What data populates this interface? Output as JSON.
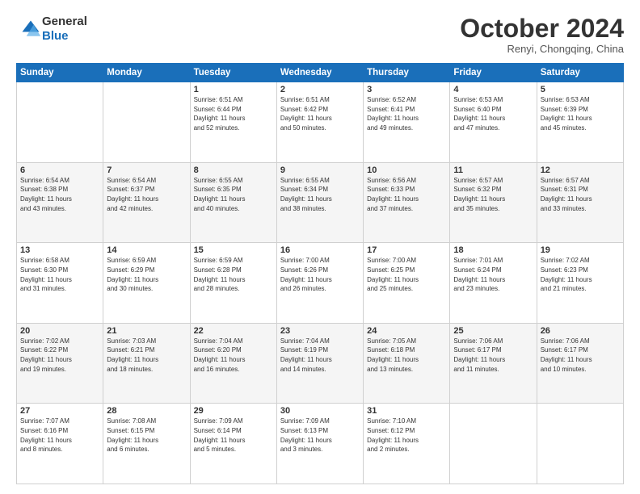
{
  "header": {
    "logo_line1": "General",
    "logo_line2": "Blue",
    "month": "October 2024",
    "location": "Renyi, Chongqing, China"
  },
  "weekdays": [
    "Sunday",
    "Monday",
    "Tuesday",
    "Wednesday",
    "Thursday",
    "Friday",
    "Saturday"
  ],
  "weeks": [
    [
      {
        "day": "",
        "info": ""
      },
      {
        "day": "",
        "info": ""
      },
      {
        "day": "1",
        "info": "Sunrise: 6:51 AM\nSunset: 6:44 PM\nDaylight: 11 hours\nand 52 minutes."
      },
      {
        "day": "2",
        "info": "Sunrise: 6:51 AM\nSunset: 6:42 PM\nDaylight: 11 hours\nand 50 minutes."
      },
      {
        "day": "3",
        "info": "Sunrise: 6:52 AM\nSunset: 6:41 PM\nDaylight: 11 hours\nand 49 minutes."
      },
      {
        "day": "4",
        "info": "Sunrise: 6:53 AM\nSunset: 6:40 PM\nDaylight: 11 hours\nand 47 minutes."
      },
      {
        "day": "5",
        "info": "Sunrise: 6:53 AM\nSunset: 6:39 PM\nDaylight: 11 hours\nand 45 minutes."
      }
    ],
    [
      {
        "day": "6",
        "info": "Sunrise: 6:54 AM\nSunset: 6:38 PM\nDaylight: 11 hours\nand 43 minutes."
      },
      {
        "day": "7",
        "info": "Sunrise: 6:54 AM\nSunset: 6:37 PM\nDaylight: 11 hours\nand 42 minutes."
      },
      {
        "day": "8",
        "info": "Sunrise: 6:55 AM\nSunset: 6:35 PM\nDaylight: 11 hours\nand 40 minutes."
      },
      {
        "day": "9",
        "info": "Sunrise: 6:55 AM\nSunset: 6:34 PM\nDaylight: 11 hours\nand 38 minutes."
      },
      {
        "day": "10",
        "info": "Sunrise: 6:56 AM\nSunset: 6:33 PM\nDaylight: 11 hours\nand 37 minutes."
      },
      {
        "day": "11",
        "info": "Sunrise: 6:57 AM\nSunset: 6:32 PM\nDaylight: 11 hours\nand 35 minutes."
      },
      {
        "day": "12",
        "info": "Sunrise: 6:57 AM\nSunset: 6:31 PM\nDaylight: 11 hours\nand 33 minutes."
      }
    ],
    [
      {
        "day": "13",
        "info": "Sunrise: 6:58 AM\nSunset: 6:30 PM\nDaylight: 11 hours\nand 31 minutes."
      },
      {
        "day": "14",
        "info": "Sunrise: 6:59 AM\nSunset: 6:29 PM\nDaylight: 11 hours\nand 30 minutes."
      },
      {
        "day": "15",
        "info": "Sunrise: 6:59 AM\nSunset: 6:28 PM\nDaylight: 11 hours\nand 28 minutes."
      },
      {
        "day": "16",
        "info": "Sunrise: 7:00 AM\nSunset: 6:26 PM\nDaylight: 11 hours\nand 26 minutes."
      },
      {
        "day": "17",
        "info": "Sunrise: 7:00 AM\nSunset: 6:25 PM\nDaylight: 11 hours\nand 25 minutes."
      },
      {
        "day": "18",
        "info": "Sunrise: 7:01 AM\nSunset: 6:24 PM\nDaylight: 11 hours\nand 23 minutes."
      },
      {
        "day": "19",
        "info": "Sunrise: 7:02 AM\nSunset: 6:23 PM\nDaylight: 11 hours\nand 21 minutes."
      }
    ],
    [
      {
        "day": "20",
        "info": "Sunrise: 7:02 AM\nSunset: 6:22 PM\nDaylight: 11 hours\nand 19 minutes."
      },
      {
        "day": "21",
        "info": "Sunrise: 7:03 AM\nSunset: 6:21 PM\nDaylight: 11 hours\nand 18 minutes."
      },
      {
        "day": "22",
        "info": "Sunrise: 7:04 AM\nSunset: 6:20 PM\nDaylight: 11 hours\nand 16 minutes."
      },
      {
        "day": "23",
        "info": "Sunrise: 7:04 AM\nSunset: 6:19 PM\nDaylight: 11 hours\nand 14 minutes."
      },
      {
        "day": "24",
        "info": "Sunrise: 7:05 AM\nSunset: 6:18 PM\nDaylight: 11 hours\nand 13 minutes."
      },
      {
        "day": "25",
        "info": "Sunrise: 7:06 AM\nSunset: 6:17 PM\nDaylight: 11 hours\nand 11 minutes."
      },
      {
        "day": "26",
        "info": "Sunrise: 7:06 AM\nSunset: 6:17 PM\nDaylight: 11 hours\nand 10 minutes."
      }
    ],
    [
      {
        "day": "27",
        "info": "Sunrise: 7:07 AM\nSunset: 6:16 PM\nDaylight: 11 hours\nand 8 minutes."
      },
      {
        "day": "28",
        "info": "Sunrise: 7:08 AM\nSunset: 6:15 PM\nDaylight: 11 hours\nand 6 minutes."
      },
      {
        "day": "29",
        "info": "Sunrise: 7:09 AM\nSunset: 6:14 PM\nDaylight: 11 hours\nand 5 minutes."
      },
      {
        "day": "30",
        "info": "Sunrise: 7:09 AM\nSunset: 6:13 PM\nDaylight: 11 hours\nand 3 minutes."
      },
      {
        "day": "31",
        "info": "Sunrise: 7:10 AM\nSunset: 6:12 PM\nDaylight: 11 hours\nand 2 minutes."
      },
      {
        "day": "",
        "info": ""
      },
      {
        "day": "",
        "info": ""
      }
    ]
  ]
}
